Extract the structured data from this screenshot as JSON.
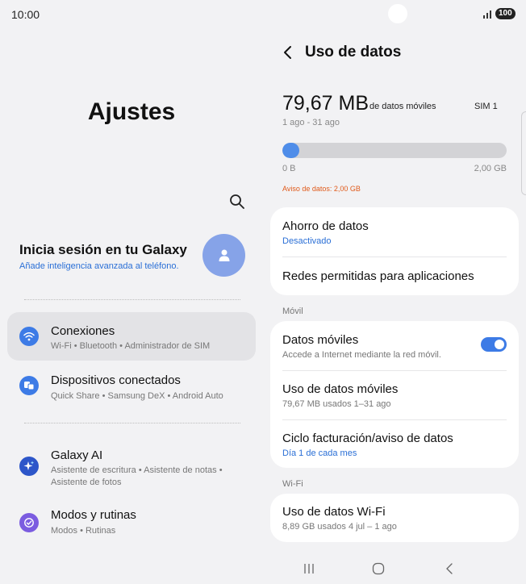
{
  "status": {
    "time": "10:00",
    "battery": "100"
  },
  "left": {
    "title": "Ajustes",
    "account": {
      "title": "Inicia sesión en tu Galaxy",
      "subtitle": "Añade inteligencia avanzada al teléfono."
    },
    "items": [
      {
        "title": "Conexiones",
        "subtitle": "Wi-Fi • Bluetooth • Administrador de SIM",
        "icon": "wifi-icon",
        "color": "#3d7be6"
      },
      {
        "title": "Dispositivos conectados",
        "subtitle": "Quick Share • Samsung DeX • Android Auto",
        "icon": "devices-icon",
        "color": "#3d7be6"
      },
      {
        "title": "Galaxy AI",
        "subtitle": "Asistente de escritura • Asistente de notas • Asistente de fotos",
        "icon": "sparkle-icon",
        "color": "#2d56c9"
      },
      {
        "title": "Modos y rutinas",
        "subtitle": "Modos • Rutinas",
        "icon": "check-circle-icon",
        "color": "#7b5ce0"
      }
    ]
  },
  "right": {
    "title": "Uso de datos",
    "usage": {
      "value": "79,67 MB",
      "unit_label": "de datos móviles",
      "sim": "SIM 1",
      "period": "1 ago - 31 ago",
      "bar_fraction": 0.04,
      "bar_min": "0 B",
      "bar_max": "2,00 GB",
      "warning": "Aviso de datos: 2,00 GB"
    },
    "card1": [
      {
        "title": "Ahorro de datos",
        "subtitle": "Desactivado"
      },
      {
        "title": "Redes permitidas para aplicaciones"
      }
    ],
    "section_mobile": "Móvil",
    "card2": [
      {
        "title": "Datos móviles",
        "subtitle": "Accede a Internet mediante la red móvil.",
        "toggle": true
      },
      {
        "title": "Uso de datos móviles",
        "subtitle": "79,67 MB usados 1–31 ago"
      },
      {
        "title": "Ciclo facturación/aviso de datos",
        "subtitle": "Día 1 de cada mes"
      }
    ],
    "section_wifi": "Wi-Fi",
    "card3": [
      {
        "title": "Uso de datos Wi-Fi",
        "subtitle": "8,89 GB usados 4 jul – 1 ago"
      }
    ]
  },
  "colors": {
    "accent": "#3d7be6",
    "warning": "#e05a1a",
    "link": "#2a6fd6"
  }
}
